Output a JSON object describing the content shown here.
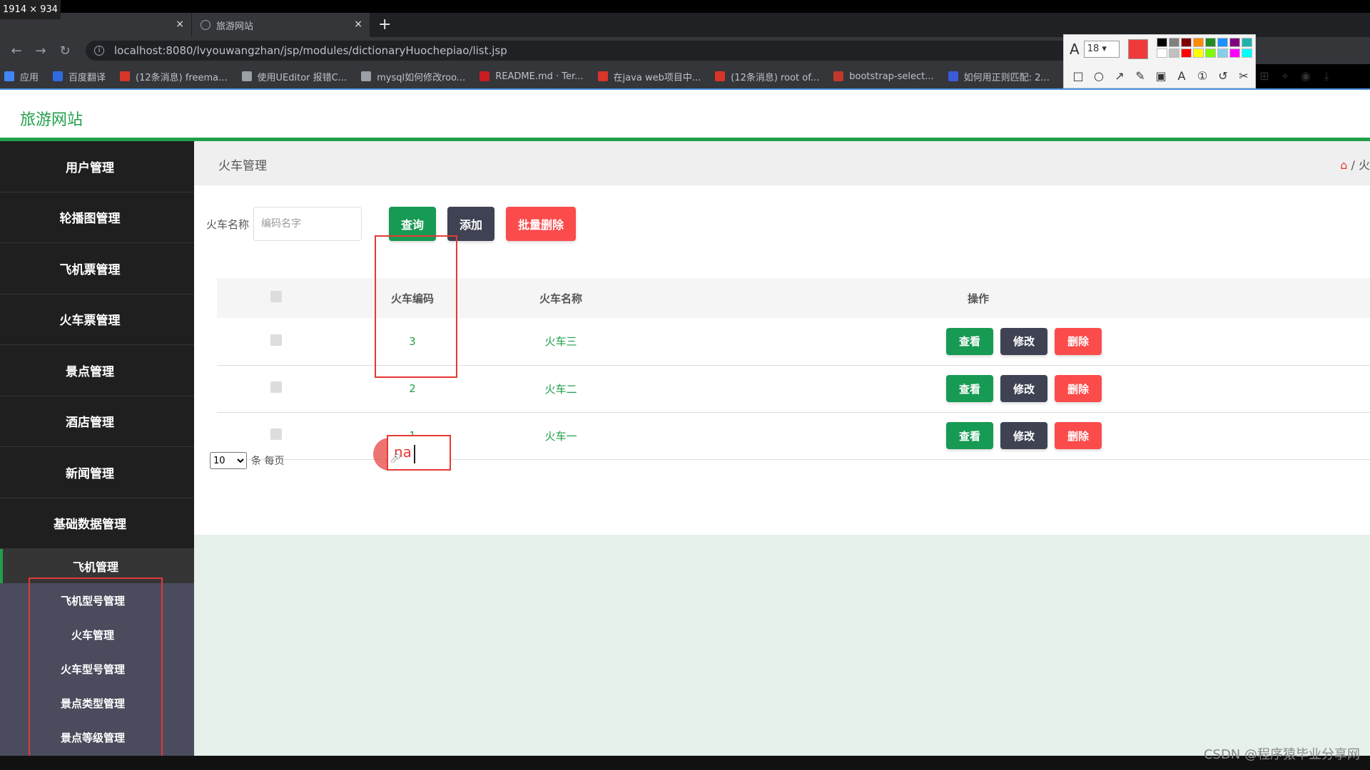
{
  "browser": {
    "size_badge": "1914 × 934",
    "tabs": [
      {
        "label": ""
      },
      {
        "label": "旅游网站"
      }
    ],
    "tab_close": "×",
    "new_tab": "+",
    "url": "localhost:8080/lvyouwangzhan/jsp/modules/dictionaryHuochepiao/list.jsp",
    "bookmarks": [
      {
        "label": "应用",
        "color": "#4285f4"
      },
      {
        "label": "百度翻译",
        "color": "#2f6bdf"
      },
      {
        "label": "(12条消息) freema...",
        "color": "#d8352a"
      },
      {
        "label": "使用UEditor 报错C...",
        "color": "#9aa0a6"
      },
      {
        "label": "mysql如何修改roo...",
        "color": "#9aa0a6"
      },
      {
        "label": "README.md · Ter...",
        "color": "#c71d23"
      },
      {
        "label": "在java web项目中...",
        "color": "#d8352a"
      },
      {
        "label": "(12条消息) root of...",
        "color": "#d8352a"
      },
      {
        "label": "bootstrap-select...",
        "color": "#c0392b"
      },
      {
        "label": "如何用正则匹配: 2...",
        "color": "#3b5bdb"
      }
    ]
  },
  "annotation_tool": {
    "font_size": "18",
    "current_color": "#f03a3a",
    "palette": [
      "#000000",
      "#808080",
      "#800000",
      "#ff8c00",
      "#228b22",
      "#1e90ff",
      "#800080",
      "#20b2aa",
      "#ffffff",
      "#c0c0c0",
      "#ff0000",
      "#ffff00",
      "#7cfc00",
      "#87ceeb",
      "#ff00ff",
      "#00ffff"
    ]
  },
  "site": {
    "brand": "旅游网站",
    "sidebar": {
      "items": [
        "用户管理",
        "轮播图管理",
        "飞机票管理",
        "火车票管理",
        "景点管理",
        "酒店管理",
        "新闻管理",
        "基础数据管理"
      ],
      "group": "飞机管理",
      "sub_items": [
        "飞机型号管理",
        "火车管理",
        "火车型号管理",
        "景点类型管理",
        "景点等级管理"
      ]
    },
    "breadcrumb": {
      "title": "火车管理",
      "right": "/ 火"
    },
    "search": {
      "label": "火车名称",
      "placeholder": "编码名字",
      "query_label": "查询",
      "add_label": "添加",
      "batch_delete_label": "批量删除"
    },
    "table": {
      "headers": [
        "",
        "火车编码",
        "火车名称",
        "操作"
      ],
      "rows": [
        {
          "code": "3",
          "name": "火车三"
        },
        {
          "code": "2",
          "name": "火车二"
        },
        {
          "code": "1",
          "name": "火车一"
        }
      ],
      "actions": {
        "view": "查看",
        "edit": "修改",
        "delete": "删除"
      }
    },
    "pager": {
      "page_size": "10",
      "per_page_text": "条 每页",
      "jump_input_text": "na"
    }
  },
  "watermark": "CSDN @程序猿毕业分享网"
}
